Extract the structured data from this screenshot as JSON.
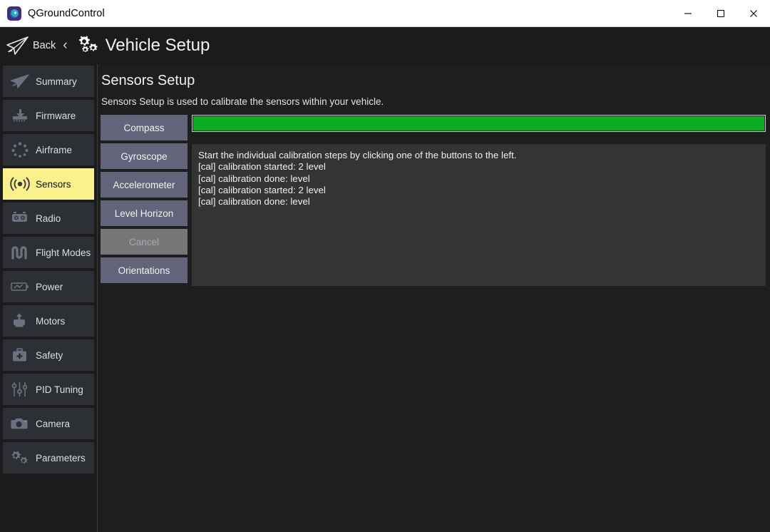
{
  "window": {
    "app_title": "QGroundControl",
    "app_icon": "qgroundcontrol-logo-icon",
    "minimize_label": "—",
    "maximize_label": "□",
    "close_label": "✕"
  },
  "header": {
    "back_label": "Back",
    "back_chevron": "‹",
    "plane_icon": "paper-plane-icon",
    "gears_icon": "gears-icon",
    "title": "Vehicle Setup"
  },
  "sidebar": {
    "items": [
      {
        "label": "Summary",
        "icon": "paper-plane-icon",
        "active": false
      },
      {
        "label": "Firmware",
        "icon": "download-chip-icon",
        "active": false
      },
      {
        "label": "Airframe",
        "icon": "airframe-dots-icon",
        "active": false
      },
      {
        "label": "Sensors",
        "icon": "sensor-waves-icon",
        "active": true
      },
      {
        "label": "Radio",
        "icon": "rc-transmitter-icon",
        "active": false
      },
      {
        "label": "Flight Modes",
        "icon": "waveform-icon",
        "active": false
      },
      {
        "label": "Power",
        "icon": "battery-icon",
        "active": false
      },
      {
        "label": "Motors",
        "icon": "motor-icon",
        "active": false
      },
      {
        "label": "Safety",
        "icon": "first-aid-kit-icon",
        "active": false
      },
      {
        "label": "PID Tuning",
        "icon": "sliders-icon",
        "active": false
      },
      {
        "label": "Camera",
        "icon": "camera-icon",
        "active": false
      },
      {
        "label": "Parameters",
        "icon": "gears-icon",
        "active": false
      }
    ]
  },
  "main": {
    "page_title": "Sensors Setup",
    "page_description": "Sensors Setup is used to calibrate the sensors within your vehicle.",
    "buttons": [
      {
        "label": "Compass",
        "disabled": false
      },
      {
        "label": "Gyroscope",
        "disabled": false
      },
      {
        "label": "Accelerometer",
        "disabled": false
      },
      {
        "label": "Level Horizon",
        "disabled": false
      },
      {
        "label": "Cancel",
        "disabled": true
      },
      {
        "label": "Orientations",
        "disabled": false
      }
    ],
    "progress": {
      "percent": 100,
      "fill_color": "#0cad22",
      "border_color": "#c9c9c9"
    },
    "log_lines": [
      "Start the individual calibration steps by clicking one of the buttons to the left.",
      "[cal] calibration started: 2 level",
      "[cal] calibration done: level",
      "[cal] calibration started: 2 level",
      "[cal] calibration done: level"
    ]
  },
  "colors": {
    "accent_highlight": "#fbf18c",
    "button_bg": "#62657a",
    "button_disabled_bg": "#77777a",
    "panel_bg": "#343434",
    "app_bg": "#1e1e1e"
  }
}
